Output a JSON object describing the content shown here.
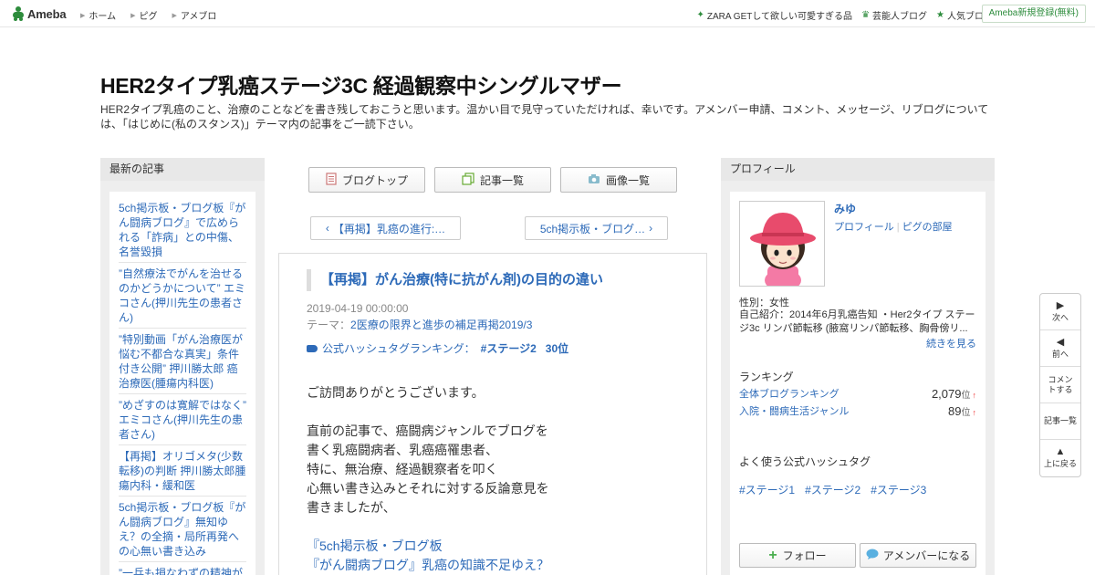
{
  "topbar": {
    "logo": "Ameba",
    "nav": [
      "ホーム",
      "ピグ",
      "アメブロ"
    ],
    "right_links": [
      "ZARA GETして欲しい可愛すぎる品",
      "芸能人ブログ",
      "人気ブログ"
    ],
    "register": "Ameba新規登録(無料)"
  },
  "header": {
    "title": "HER2タイプ乳癌ステージ3C 経過観察中シングルマザー",
    "description": "HER2タイプ乳癌のこと、治療のことなどを書き残しておこうと思います。温かい目で見守っていただければ、幸いです。アメンバー申請、コメント、メッセージ、リブログについては、「はじめに(私のスタンス)」テーマ内の記事をご一読下さい。"
  },
  "left_sidebar": {
    "heading": "最新の記事",
    "items": [
      "5ch掲示板・ブログ板『がん闘病ブログ』で広められる「詐病」との中傷、名誉毀損",
      "”自然療法でがんを治せるのかどうかについて” エミコさん(押川先生の患者さん)",
      "”特別動画「がん治療医が悩む不都合な真実」条件付き公開” 押川勝太郎 癌治療医(腫瘍内科医)",
      "”めざすのは寛解ではなく” エミコさん(押川先生の患者さん)",
      "【再掲】オリゴメタ(少数転移)の判断 押川勝太郎腫瘍内科・緩和医",
      "5ch掲示板・ブログ板『がん闘病ブログ』無知ゆえ？の全摘・局所再発への心無い書き込み",
      "”一兵も損なわずの精神が"
    ]
  },
  "center": {
    "buttons": [
      "ブログトップ",
      "記事一覧",
      "画像一覧"
    ],
    "prev": "【再掲】乳癌の進行:…",
    "next": "5ch掲示板・ブログ…",
    "entry": {
      "title": "【再掲】がん治療(特に抗がん剤)の目的の違い",
      "date": "2019-04-19 00:00:00",
      "theme_label": "テーマ：",
      "theme": "2医療の限界と進歩の補足再掲2019/3",
      "hashtag_label": "公式ハッシュタグランキング：",
      "hashtag": "#ステージ2",
      "hashtag_rank": "30位",
      "body": [
        "ご訪問ありがとうございます。",
        "",
        "直前の記事で、癌闘病ジャンルでブログを",
        "書く乳癌闘病者、乳癌癌罹患者、",
        "特に、無治療、経過観察者を叩く",
        "心無い書き込みとそれに対する反論意見を",
        "書きましたが、",
        "",
        "『5ch掲示板・ブログ板",
        "『がん闘病ブログ』乳癌の知識不足ゆえ？"
      ]
    }
  },
  "right_sidebar": {
    "heading": "プロフィール",
    "name": "みゆ",
    "profile_link": "プロフィール",
    "pig_link": "ピグの部屋",
    "gender": "性別：女性",
    "intro": "自己紹介：2014年6月乳癌告知 ・Her2タイプ ステージ3c リンパ節転移 (腋窩リンパ節転移、胸骨傍リ...",
    "more": "続きを見る",
    "ranking_heading": "ランキング",
    "rankings": [
      {
        "label": "全体ブログランキング",
        "value": "2,079",
        "unit": "位",
        "trend": "↑"
      },
      {
        "label": "入院・闘病生活ジャンル",
        "value": "89",
        "unit": "位",
        "trend": "↑"
      }
    ],
    "hashtag_heading": "よく使う公式ハッシュタグ",
    "hashtags": [
      "#ステージ1",
      "#ステージ2",
      "#ステージ3"
    ],
    "follow": "フォロー",
    "amember": "アメンバーになる"
  },
  "float_nav": [
    {
      "icon": "▶",
      "label": "次へ"
    },
    {
      "icon": "◀",
      "label": "前へ"
    },
    {
      "icon": "",
      "label": "コメントする"
    },
    {
      "icon": "",
      "label": "記事一覧"
    },
    {
      "icon": "▲",
      "label": "上に戻る"
    }
  ],
  "colors": {
    "brand": "#2d8c3c",
    "link": "#2d6ab8",
    "sidebar_bg": "#eeeeee"
  }
}
